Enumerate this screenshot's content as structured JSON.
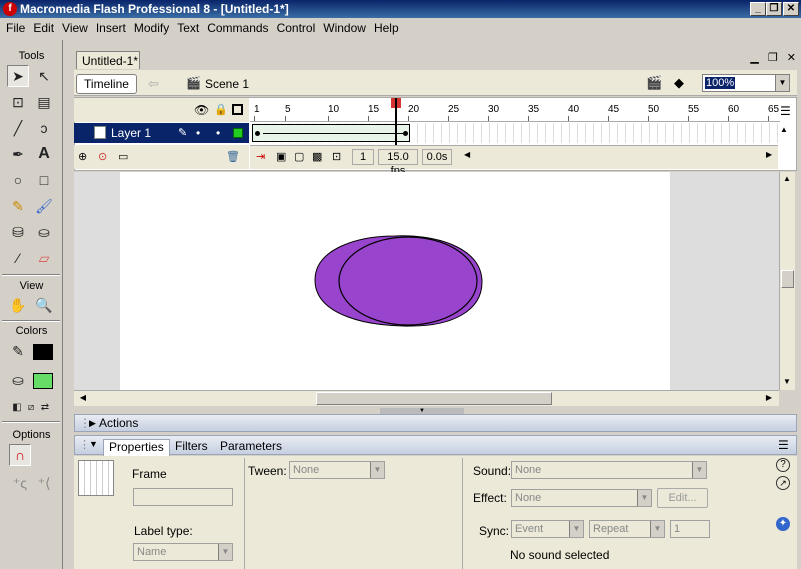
{
  "window": {
    "title": "Macromedia Flash Professional 8 - [Untitled-1*]",
    "logo_glyph": "f",
    "min_glyph": "_",
    "restore_glyph": "❐",
    "close_glyph": "✕"
  },
  "menu": [
    "File",
    "Edit",
    "View",
    "Insert",
    "Modify",
    "Text",
    "Commands",
    "Control",
    "Window",
    "Help"
  ],
  "tools": {
    "header": "Tools",
    "view_header": "View",
    "colors_header": "Colors",
    "options_header": "Options",
    "stroke_color": "#000000",
    "fill_color": "#66dd66"
  },
  "document": {
    "tab_label": "Untitled-1*",
    "timeline_button": "Timeline",
    "scene_label": "Scene 1",
    "zoom_value": "100%"
  },
  "timeline": {
    "layer_name": "Layer 1",
    "ruler_labels": [
      "1",
      "5",
      "10",
      "15",
      "20",
      "25",
      "30",
      "35",
      "40",
      "45",
      "50",
      "55",
      "60",
      "65"
    ],
    "current_frame": "1",
    "frame_rate": "15.0 fps",
    "elapsed_time": "0.0s"
  },
  "stage": {
    "shape_fill": "#9944cc",
    "shape_stroke": "#000000"
  },
  "panels": {
    "actions_label": "Actions",
    "tabs": [
      "Properties",
      "Filters",
      "Parameters"
    ],
    "frame_label": "Frame",
    "frame_name_value": "",
    "label_type_label": "Label type:",
    "label_type_value": "Name",
    "tween_label": "Tween:",
    "tween_value": "None",
    "sound_label": "Sound:",
    "sound_value": "None",
    "effect_label": "Effect:",
    "effect_value": "None",
    "edit_button": "Edit...",
    "sync_label": "Sync:",
    "sync_value": "Event",
    "repeat_value": "Repeat",
    "repeat_count": "1",
    "no_sound_text": "No sound selected"
  }
}
